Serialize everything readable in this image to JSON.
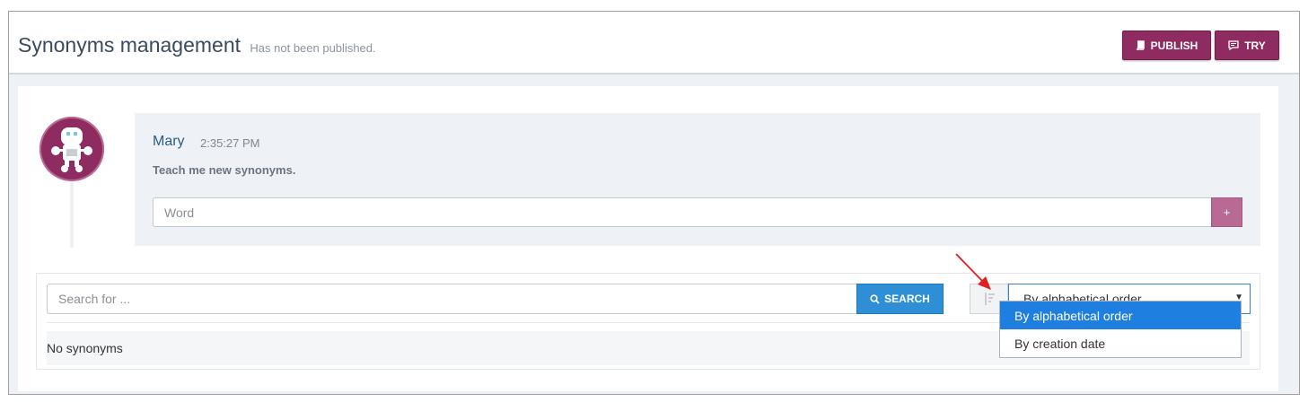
{
  "header": {
    "title": "Synonyms management",
    "status": "Has not been published.",
    "publish_label": "PUBLISH",
    "try_label": "TRY"
  },
  "bot": {
    "name": "Mary",
    "time": "2:35:27 PM",
    "message": "Teach me new synonyms.",
    "word_placeholder": "Word",
    "add_label": "+"
  },
  "synonyms": {
    "search_placeholder": "Search for ...",
    "search_label": "SEARCH",
    "sort_selected": "By alphabetical order",
    "sort_options": [
      "By alphabetical order",
      "By creation date"
    ],
    "empty_text": "No synonyms"
  },
  "colors": {
    "brand": "#8e2c61",
    "search": "#2f8fd6",
    "selected_option": "#1e7fe0"
  },
  "icons": {
    "publish": "book-icon",
    "try": "chat-icon",
    "search": "search-icon",
    "sort": "sort-icon",
    "caret": "caret-down-icon"
  }
}
